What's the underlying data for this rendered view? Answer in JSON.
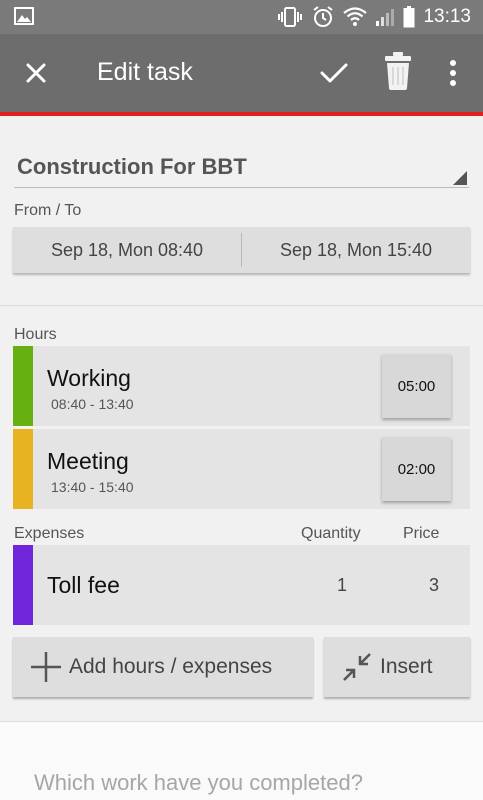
{
  "status_bar": {
    "time": "13:13"
  },
  "toolbar": {
    "title": "Edit task",
    "icons": [
      "close-icon",
      "check-icon",
      "trash-icon",
      "more-vert-icon"
    ]
  },
  "task": {
    "name": "Construction For BBT"
  },
  "from_to": {
    "label": "From / To",
    "from": "Sep 18, Mon 08:40",
    "to": "Sep 18, Mon 15:40"
  },
  "hours": {
    "label": "Hours",
    "items": [
      {
        "name": "Working",
        "range": "08:40 - 13:40",
        "duration": "05:00",
        "color": "#66b012"
      },
      {
        "name": "Meeting",
        "range": "13:40 - 15:40",
        "duration": "02:00",
        "color": "#e8b323"
      }
    ]
  },
  "expenses": {
    "label": "Expenses",
    "quantity_header": "Quantity",
    "price_header": "Price",
    "items": [
      {
        "name": "Toll fee",
        "quantity": "1",
        "price": "3",
        "color": "#6f26d9"
      }
    ]
  },
  "actions": {
    "add_label": "Add hours / expenses",
    "insert_label": "Insert"
  },
  "notes": {
    "placeholder": "Which work have you completed?"
  },
  "colors": {
    "accent": "#e0201f",
    "toolbar": "#6d6d6d"
  }
}
